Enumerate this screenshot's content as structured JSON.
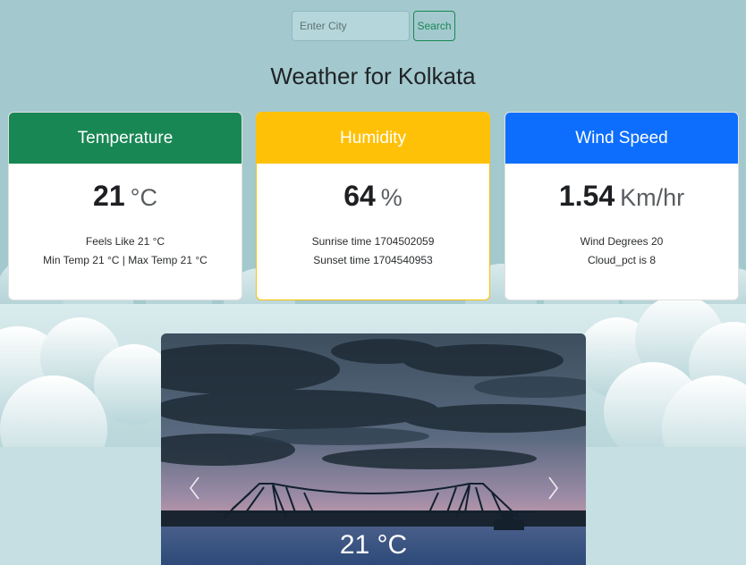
{
  "search": {
    "placeholder": "Enter City",
    "button_label": "Search"
  },
  "title": "Weather for Kolkata",
  "cards": {
    "temperature": {
      "header": "Temperature",
      "value": "21",
      "unit": "°C",
      "line1": "Feels Like 21 °C",
      "line2": "Min Temp 21 °C | Max Temp 21 °C",
      "color": "#198754"
    },
    "humidity": {
      "header": "Humidity",
      "value": "64",
      "unit": "%",
      "line1": "Sunrise time 1704502059",
      "line2": "Sunset time 1704540953",
      "color": "#ffc107"
    },
    "wind": {
      "header": "Wind Speed",
      "value": "1.54",
      "unit": "Km/hr",
      "line1": "Wind Degrees 20",
      "line2": "Cloud_pct is 8",
      "color": "#0d6efd"
    }
  },
  "carousel": {
    "caption": "21 °C",
    "prev_icon": "chevron-left-icon",
    "next_icon": "chevron-right-icon"
  }
}
